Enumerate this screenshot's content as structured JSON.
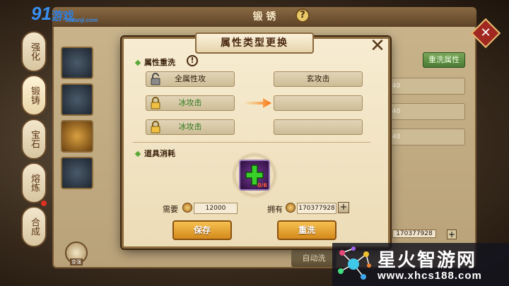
{
  "logo": {
    "brand": "91",
    "name": "游戏",
    "sub": "91danji.com"
  },
  "window": {
    "title": "锻 锈",
    "help": "?"
  },
  "left_tabs": [
    "强化",
    "锻铸",
    "宝石",
    "熔炼",
    "合成"
  ],
  "right_panel": {
    "rewash_label": "重洗属性",
    "bars": [
      "140",
      "140",
      "140"
    ],
    "own_value": "170377928",
    "auto_label": "自动洗"
  },
  "modal": {
    "title": "属性类型更换",
    "close": "✕",
    "section_rewash": "属性重洗",
    "warn": "!",
    "left_attrs": [
      "全属性攻",
      "冰攻击",
      "冰攻击"
    ],
    "right_attrs": [
      "玄攻击",
      "",
      ""
    ],
    "section_items": "道具消耗",
    "item_count": "0/6",
    "need_label": "需要",
    "need_value": "12000",
    "own_label": "拥有",
    "own_value": "170377928",
    "plus": "+",
    "save_label": "保存",
    "rewash_label": "重洗"
  },
  "bottom_icon_label": "变强",
  "watermark": {
    "title": "星火智游网",
    "url": "www.xhcs188.com"
  },
  "colors": {
    "accent_orange": "#d48a1c",
    "green_text": "#2e7a1c",
    "item_purple": "#7a3a9a"
  }
}
